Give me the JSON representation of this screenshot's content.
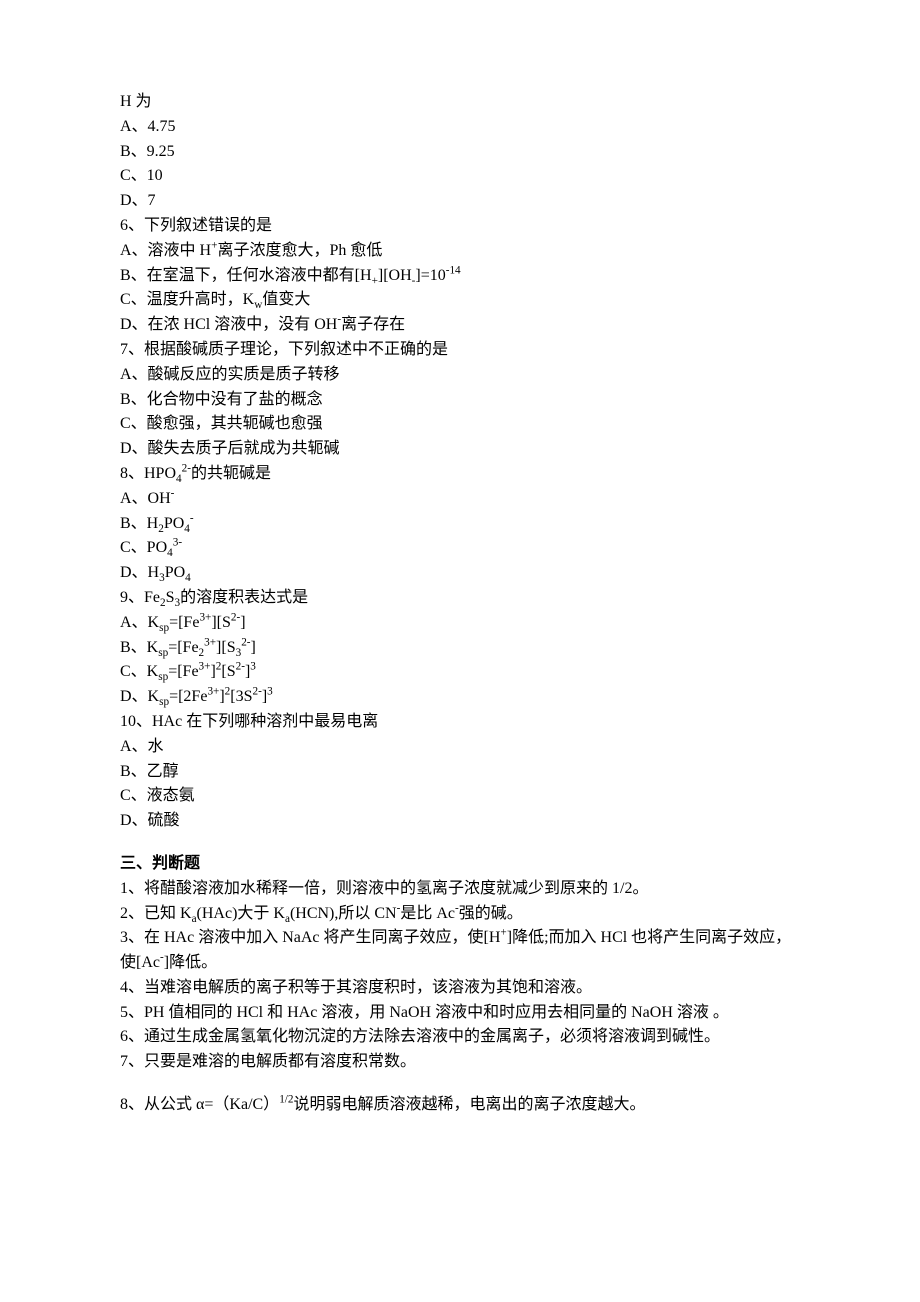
{
  "q5": {
    "stem": "H 为",
    "A": "A、4.75",
    "B": "B、9.25",
    "C": "C、10",
    "D": "D、7"
  },
  "q6": {
    "stem": "6、下列叙述错误的是",
    "A_pre": "A、溶液中 H",
    "A_sup1": "+",
    "A_post": "离子浓度愈大，Ph 愈低",
    "B_pre": "B、在室温下，任何水溶液中都有[H",
    "B_sub1": "+",
    "B_mid": "][OH",
    "B_sub2": "-",
    "B_mid2": "]=10",
    "B_sup1": "-14",
    "C_pre": "C、温度升高时，K",
    "C_sub": "w",
    "C_post": "值变大",
    "D_pre": "D、在浓 HCl 溶液中，没有 OH",
    "D_sup": "-",
    "D_post": "离子存在"
  },
  "q7": {
    "stem": "7、根据酸碱质子理论，下列叙述中不正确的是",
    "A": "A、酸碱反应的实质是质子转移",
    "B": "B、化合物中没有了盐的概念",
    "C": "C、酸愈强，其共轭碱也愈强",
    "D": "D、酸失去质子后就成为共轭碱"
  },
  "q8": {
    "stem_pre": "8、HPO",
    "stem_sub": "4",
    "stem_sup": "2-",
    "stem_post": "的共轭碱是",
    "A_pre": "A、OH",
    "A_sup": "-",
    "B_pre": "B、H",
    "B_sub1": "2",
    "B_mid": "PO",
    "B_sub2": "4",
    "B_sup": "-",
    "C_pre": "C、PO",
    "C_sub": "4",
    "C_sup": "3-",
    "D_pre": "D、H",
    "D_sub1": "3",
    "D_mid": "PO",
    "D_sub2": "4"
  },
  "q9": {
    "stem_pre": "9、Fe",
    "stem_s1": "2",
    "stem_m": "S",
    "stem_s2": "3",
    "stem_post": "的溶度积表达式是",
    "A_pre": "A、K",
    "A_sp": "sp",
    "A_eq": "=[Fe",
    "A_s1": "3+",
    "A_m": "][S",
    "A_s2": "2-",
    "A_end": "]",
    "B_pre": "B、K",
    "B_sp": "sp",
    "B_eq": "=[Fe",
    "B_s1": "2",
    "B_s1b": "3+",
    "B_m": "][S",
    "B_s2": "3",
    "B_s2b": "2-",
    "B_end": "]",
    "C_pre": "C、K",
    "C_sp": "sp",
    "C_eq": "=[Fe",
    "C_s1": "3+",
    "C_p1": "]",
    "C_e1": "2",
    "C_m": "[S",
    "C_s2": "2-",
    "C_p2": "]",
    "C_e2": "3",
    "D_pre": "D、K",
    "D_sp": "sp",
    "D_eq": "=[2Fe",
    "D_s1": "3+",
    "D_p1": "]",
    "D_e1": "2",
    "D_m": "[3S",
    "D_s2": "2-",
    "D_p2": "]",
    "D_e2": "3"
  },
  "q10": {
    "stem": "10、HAc 在下列哪种溶剂中最易电离",
    "A": "A、水",
    "B": "B、乙醇",
    "C": "C、液态氨",
    "D": "D、硫酸"
  },
  "section3_title": "三、判断题",
  "j1": "1、将醋酸溶液加水稀释一倍，则溶液中的氢离子浓度就减少到原来的 1/2。",
  "j2_pre": "2、已知 K",
  "j2_sa": "a",
  "j2_m1": "(HAc)大于 K",
  "j2_sb": "a",
  "j2_m2": "(HCN),所以 CN",
  "j2_s1": "-",
  "j2_m3": "是比 Ac",
  "j2_s2": "-",
  "j2_end": "强的碱。",
  "j3_pre": "3、在 HAc 溶液中加入 NaAc 将产生同离子效应，使[H",
  "j3_s1": "+",
  "j3_mid": "]降低;而加入 HCl 也将产生同离子效应，使[Ac",
  "j3_s2": "-",
  "j3_end": "]降低。",
  "j4": "4、当难溶电解质的离子积等于其溶度积时，该溶液为其饱和溶液。",
  "j5": "5、PH 值相同的 HCl 和 HAc 溶液，用 NaOH 溶液中和时应用去相同量的 NaOH 溶液 。",
  "j6": "6、通过生成金属氢氧化物沉淀的方法除去溶液中的金属离子，必须将溶液调到碱性。",
  "j7": "7、只要是难溶的电解质都有溶度积常数。",
  "j8_pre": "8、从公式 α=（Ka/C）",
  "j8_sup": "1/2",
  "j8_end": "说明弱电解质溶液越稀，电离出的离子浓度越大。"
}
